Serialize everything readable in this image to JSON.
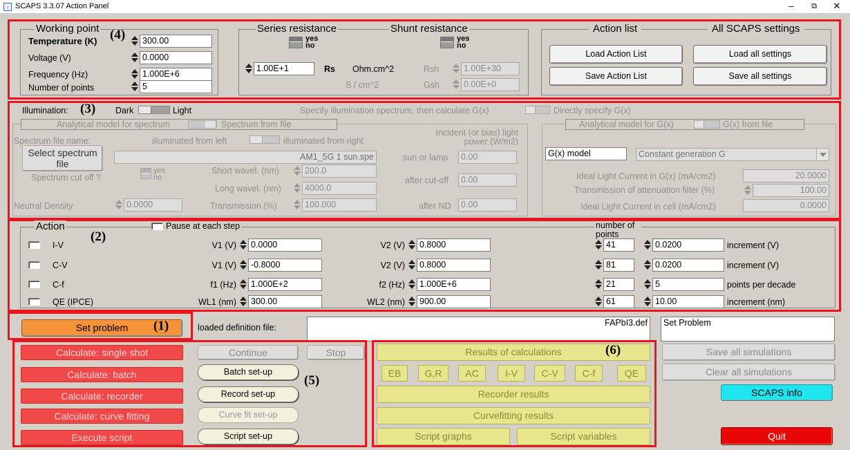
{
  "window": {
    "title": "SCAPS 3.3.07 Action Panel",
    "minimize": "–",
    "maximize": "⧉",
    "close": "✕"
  },
  "numbers": {
    "n1": "(1)",
    "n2": "(2)",
    "n3": "(3)",
    "n4": "(4)",
    "n5": "(5)",
    "n6": "(6)"
  },
  "working_point": {
    "legend": "Working point",
    "temperature_label": "Temperature (K)",
    "temperature": "300.00",
    "voltage_label": "Voltage (V)",
    "voltage": "0.0000",
    "frequency_label": "Frequency (Hz)",
    "frequency": "1.000E+6",
    "points_label": "Number of points",
    "points": "5"
  },
  "resistance": {
    "series_legend": "Series resistance",
    "shunt_legend": "Shunt resistance",
    "yes": "yes",
    "no": "no",
    "rs_value": "1.00E+1",
    "rs_label": "Rs",
    "ohm_unit": "Ohm.cm^2",
    "s_unit": "S / cm^2",
    "rsh_label": "Rsh",
    "rsh_value": "1.00E+30",
    "gsh_label": "Gsh",
    "gsh_value": "0.00E+0"
  },
  "action_list": {
    "legend": "Action list",
    "settings_legend": "All SCAPS settings",
    "load_list": "Load Action List",
    "save_list": "Save Action List",
    "load_settings": "Load all settings",
    "save_settings": "Save all settings"
  },
  "illumination": {
    "label": "Illumination:",
    "dark": "Dark",
    "light": "Light",
    "specify_spectrum": "Specify illumination spectrum, then calculate G(x)",
    "directly": "Directly specify G(x)",
    "analytical_spectrum": "Analytical model for spectrum",
    "spectrum_from_file": "Spectrum from file",
    "spectrum_file_name": "Spectrum file name:",
    "illuminated_left": "illuminated from left",
    "illuminated_right": "illuminated from right",
    "select_spectrum": "Select spectrum file",
    "spectrum_file": "AM1_5G 1 sun.spe",
    "cutoff_label": "Spectrum cut off ?",
    "yes": "yes",
    "no": "no",
    "short_label": "Short wavel. (nm)",
    "short_value": "200.0",
    "long_label": "Long wavel. (nm)",
    "long_value": "4000.0",
    "nd_label": "Neutral Density",
    "nd_value": "0.0000",
    "trans_label": "Transmission (%)",
    "trans_value": "100.000",
    "incident_label": "Incident (or bias) light power (W/m2)",
    "sun_label": "sun or lamp",
    "sun_value": "0.00",
    "cutoff_after_label": "after cut-off",
    "cutoff_after_value": "0.00",
    "nd_after_label": "after ND",
    "nd_after_value": "0.00",
    "analytical_gx": "Analytical model for G(x)",
    "gx_from_file": "G(x) from file",
    "gx_model_label": "G(x) model",
    "gx_model_value": "Constant generation G",
    "ideal_gx_label": "Ideal Light Current in G(x) (mA/cm2)",
    "ideal_gx_value": "20.0000",
    "atten_label": "Transmission of attenuation filter (%)",
    "atten_value": "100.00",
    "ideal_cell_label": "Ideal Light Current in cell (mA/cm2)",
    "ideal_cell_value": "0.0000"
  },
  "action": {
    "legend": "Action",
    "pause": "Pause at each step",
    "number_of_points": "number of points",
    "rows": [
      {
        "name": "I-V",
        "p1": "V1 (V)",
        "v1": "0.0000",
        "p2": "V2 (V)",
        "v2": "0.8000",
        "n": "41",
        "step": "0.0200",
        "unit": "increment (V)"
      },
      {
        "name": "C-V",
        "p1": "V1 (V)",
        "v1": "-0.8000",
        "p2": "V2 (V)",
        "v2": "0.8000",
        "n": "81",
        "step": "0.0200",
        "unit": "increment (V)"
      },
      {
        "name": "C-f",
        "p1": "f1 (Hz)",
        "v1": "1.000E+2",
        "p2": "f2 (Hz)",
        "v2": "1.000E+6",
        "n": "21",
        "step": "5",
        "unit": "points per decade"
      },
      {
        "name": "QE (IPCE)",
        "p1": "WL1 (nm)",
        "v1": "300.00",
        "p2": "WL2 (nm)",
        "v2": "900.00",
        "n": "61",
        "step": "10.00",
        "unit": "increment (nm)"
      }
    ]
  },
  "problem": {
    "set_problem": "Set problem",
    "loaded_label": "loaded definition file:",
    "loaded_file": "FAPbI3.def",
    "status": "Set Problem"
  },
  "calc": {
    "single": "Calculate: single shot",
    "batch": "Calculate: batch",
    "recorder": "Calculate: recorder",
    "fitting": "Calculate: curve fitting",
    "script": "Execute script",
    "continue": "Continue",
    "stop": "Stop",
    "batch_setup": "Batch set-up",
    "record_setup": "Record set-up",
    "fit_setup": "Curve fit set-up",
    "script_setup": "Script set-up"
  },
  "results": {
    "title": "Results of calculations",
    "tabs": [
      "EB",
      "G,R",
      "AC",
      "I-V",
      "C-V",
      "C-f",
      "QE"
    ],
    "recorder": "Recorder results",
    "curvefit": "Curvefitting results",
    "script_graphs": "Script graphs",
    "script_vars": "Script variables"
  },
  "side": {
    "save_all": "Save all simulations",
    "clear_all": "Clear all simulations",
    "info": "SCAPS info",
    "quit": "Quit"
  }
}
